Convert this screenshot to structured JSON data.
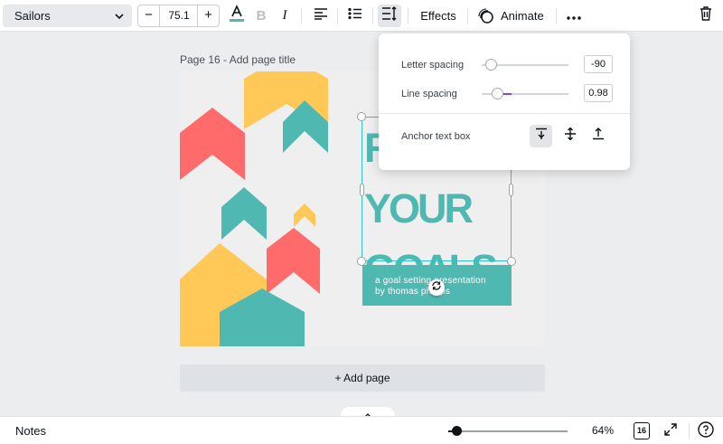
{
  "colors": {
    "teal": "#4fb8b1",
    "coral": "#ff6b6b",
    "yellow": "#ffc857",
    "selection": "#2fc4c7",
    "slider_accent": "#8b3dff"
  },
  "toolbar": {
    "font_name": "Sailors",
    "font_size": "75.1",
    "decrease_label": "−",
    "increase_label": "+",
    "bold_label": "B",
    "italic_label": "I",
    "effects_label": "Effects",
    "animate_label": "Animate",
    "icons": [
      "chevron-down-icon",
      "text-color-icon",
      "bold-icon",
      "italic-icon",
      "align-left-icon",
      "list-icon",
      "spacing-icon",
      "animate-icon",
      "more-icon",
      "trash-icon"
    ]
  },
  "canvas": {
    "page_title": "Page 16 - Add page title",
    "headline_lines": [
      "R",
      "YOUR",
      "GOALS"
    ],
    "subtitle_line1": "a goal setting presentation",
    "subtitle_line2": "by thomas phillips",
    "add_page_label": "+ Add page"
  },
  "spacing_popover": {
    "letter_spacing_label": "Letter spacing",
    "letter_spacing_value": "-90",
    "letter_spacing_fraction": 0.1,
    "line_spacing_label": "Line spacing",
    "line_spacing_value": "0.98",
    "line_spacing_fraction": 0.24,
    "anchor_label": "Anchor text box",
    "anchor_options": [
      "anchor-top-icon",
      "anchor-middle-icon",
      "anchor-bottom-icon"
    ],
    "anchor_selected": "top"
  },
  "bottom_bar": {
    "notes_label": "Notes",
    "zoom_text": "64%",
    "zoom_fraction": 0.07,
    "page_count": "16",
    "icons": [
      "collapse-chevron-icon",
      "pages-icon",
      "fullscreen-icon",
      "help-icon"
    ]
  }
}
